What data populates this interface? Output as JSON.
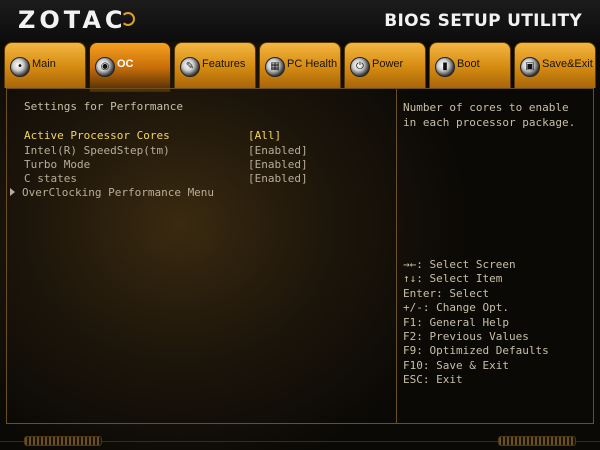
{
  "header": {
    "logo": "ZOTAC",
    "title": "BIOS SETUP UTILITY"
  },
  "tabs": [
    {
      "label": "Main",
      "icon": "main-icon"
    },
    {
      "label": "OC",
      "icon": "oc-icon",
      "active": true
    },
    {
      "label": "Features",
      "icon": "features-icon"
    },
    {
      "label": "PC Health",
      "icon": "pc-health-icon"
    },
    {
      "label": "Power",
      "icon": "power-icon"
    },
    {
      "label": "Boot",
      "icon": "boot-icon"
    },
    {
      "label": "Save&Exit",
      "icon": "save-exit-icon"
    }
  ],
  "settings": {
    "section_title": "Settings for Performance",
    "rows": [
      {
        "name": "Active Processor Cores",
        "value": "[All]",
        "selected": true
      },
      {
        "name": "Intel(R) SpeedStep(tm)",
        "value": "[Enabled]"
      },
      {
        "name": "Turbo Mode",
        "value": "[Enabled]"
      },
      {
        "name": "C states",
        "value": "[Enabled]"
      }
    ],
    "submenu": "OverClocking Performance Menu"
  },
  "help": {
    "description": "Number of cores to enable in each processor package.",
    "keys": [
      "→←: Select Screen",
      "↑↓: Select Item",
      "Enter: Select",
      "+/-: Change Opt.",
      "F1: General Help",
      "F2: Previous Values",
      "F9: Optimized Defaults",
      "F10: Save & Exit",
      "ESC: Exit"
    ]
  },
  "colors": {
    "accent": "#e0a020",
    "selected_text": "#f0d85a",
    "normal_text": "#b8ad98"
  }
}
